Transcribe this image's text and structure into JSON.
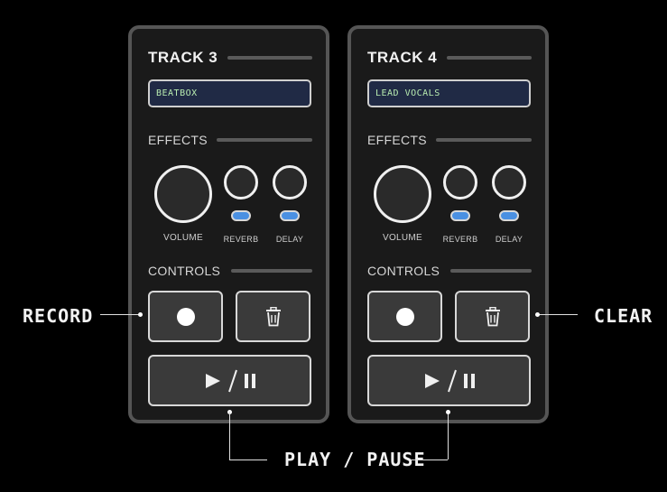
{
  "tracks": [
    {
      "title": "TRACK 3",
      "name": "BEATBOX",
      "effects_label": "EFFECTS",
      "controls_label": "CONTROLS",
      "knobs": {
        "volume": "VOLUME",
        "reverb": "REVERB",
        "delay": "DELAY"
      }
    },
    {
      "title": "TRACK 4",
      "name": "LEAD VOCALS",
      "effects_label": "EFFECTS",
      "controls_label": "CONTROLS",
      "knobs": {
        "volume": "VOLUME",
        "reverb": "REVERB",
        "delay": "DELAY"
      }
    }
  ],
  "callouts": {
    "record": "RECORD",
    "clear": "CLEAR",
    "play_pause": "PLAY / PAUSE"
  },
  "icons": {
    "record": "record-dot-icon",
    "clear": "trash-icon",
    "play": "play-icon",
    "pause": "pause-icon"
  },
  "colors": {
    "name_field_bg": "#202a45",
    "name_field_text": "#b8ecb0",
    "toggle_on": "#4a90e2",
    "panel_border": "#555555"
  }
}
